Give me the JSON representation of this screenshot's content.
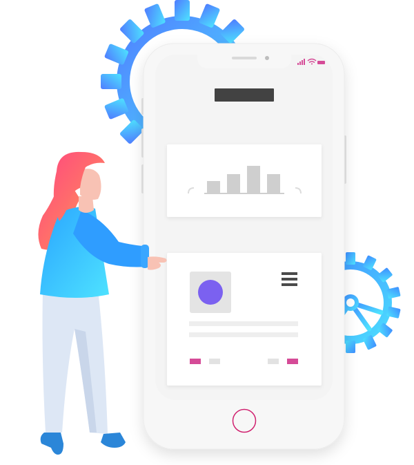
{
  "illustration": {
    "subject": "woman-touching-smartphone",
    "icons": [
      "gear-icon",
      "small-gear-icon",
      "signal-icon",
      "wifi-icon",
      "battery-icon",
      "menu-icon"
    ]
  },
  "colors": {
    "gear_gradient_start": "#4f7cff",
    "gear_gradient_end": "#4ee2ff",
    "phone_body": "#f7f7f7",
    "screen": "#f5f5f5",
    "card": "#ffffff",
    "bars": "#cfcfcf",
    "header_bar": "#424242",
    "avatar": "#7b61f0",
    "accent_pink": "#d54b97",
    "hair_start": "#ff4f7b",
    "hair_end": "#ff8a5c",
    "shirt_start": "#2aa5ff",
    "shirt_end": "#4ee2ff",
    "pants": "#dde7f5",
    "shoes": "#2b86d8",
    "skin": "#f8c2b4"
  }
}
